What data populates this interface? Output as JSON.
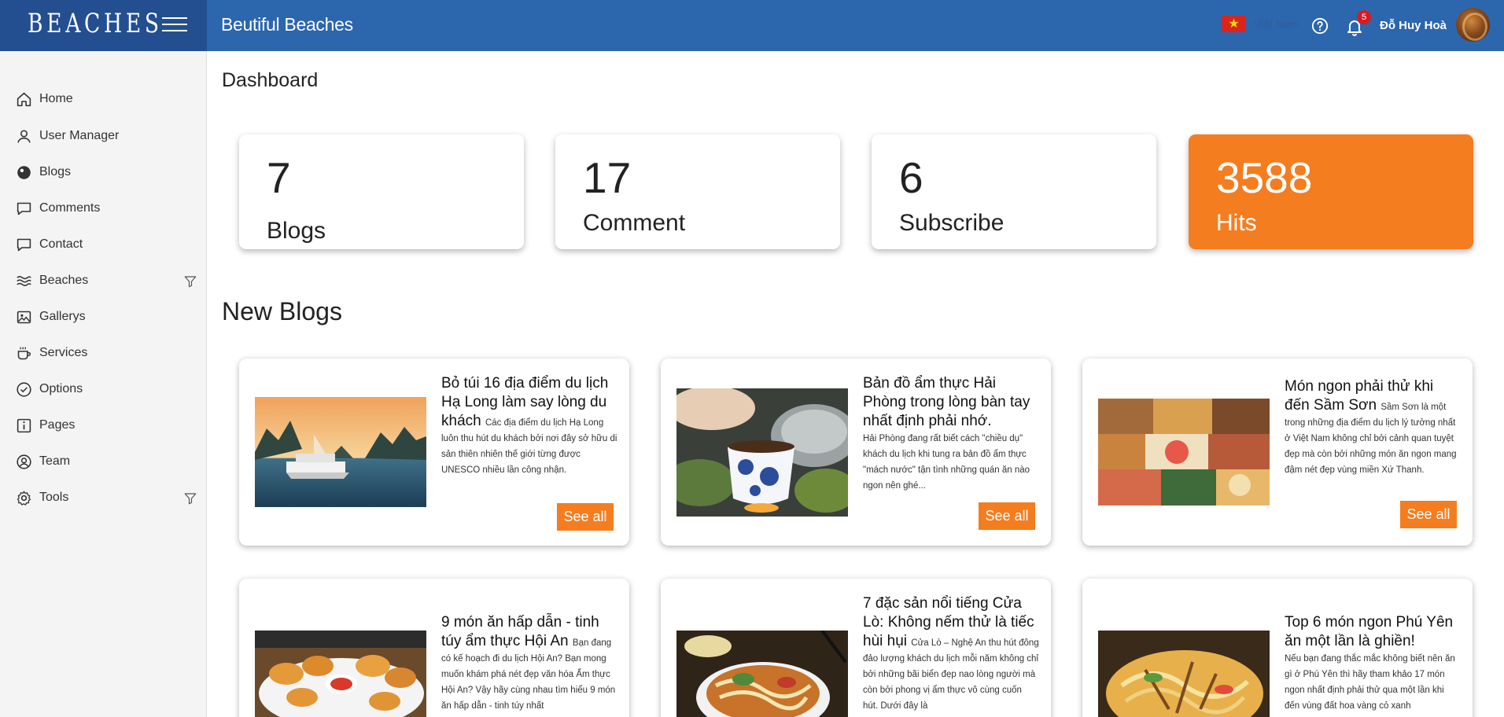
{
  "app": {
    "brand": "BEACHES",
    "site_title": "Beutiful Beaches",
    "language": "Việt Nam",
    "notifications_count": "5",
    "user_name": "Đỗ Huy Hoà"
  },
  "colors": {
    "topbar": "#2c66ad",
    "brand_bg": "#234f90",
    "accent_orange": "#f47d20",
    "sidebar_bg": "#f4f4f4"
  },
  "sidebar": {
    "items": [
      {
        "label": "Home",
        "icon": "home-icon"
      },
      {
        "label": "User Manager",
        "icon": "user-icon"
      },
      {
        "label": "Blogs",
        "icon": "blog-icon"
      },
      {
        "label": "Comments",
        "icon": "comment-icon"
      },
      {
        "label": "Contact",
        "icon": "contact-icon"
      },
      {
        "label": "Beaches",
        "icon": "waves-icon",
        "filter": true
      },
      {
        "label": "Gallerys",
        "icon": "image-icon"
      },
      {
        "label": "Services",
        "icon": "coffee-icon"
      },
      {
        "label": "Options",
        "icon": "check-circle-icon"
      },
      {
        "label": "Pages",
        "icon": "info-icon"
      },
      {
        "label": "Team",
        "icon": "team-icon"
      },
      {
        "label": "Tools",
        "icon": "gear-icon",
        "filter": true
      }
    ]
  },
  "dashboard": {
    "title": "Dashboard",
    "stats": [
      {
        "value": "7",
        "label": "Blogs"
      },
      {
        "value": "17",
        "label": "Comment"
      },
      {
        "value": "6",
        "label": "Subscribe"
      },
      {
        "value": "3588",
        "label": "Hits"
      }
    ]
  },
  "new_blogs": {
    "title": "New Blogs",
    "button_label": "See all",
    "posts": [
      {
        "title": "Bỏ túi 16 địa điểm du lịch Hạ Long làm say lòng du khách",
        "excerpt": "Các địa điểm du lịch Hạ Long luôn thu hút du khách bởi nơi đây sở hữu di sản thiên nhiên thế giới từng được UNESCO nhiều lần công nhận."
      },
      {
        "title": "Bản đồ ẩm thực Hải Phòng trong lòng bàn tay nhất định phải nhớ.",
        "excerpt": "Hải Phòng đang rất biết cách \"chiều dụ\" khách du lịch khi tung ra bản đồ ẩm thực \"mách nước\" tận tình những quán ăn nào ngon nên ghé..."
      },
      {
        "title": "Món ngon phải thử khi đến Sầm Sơn",
        "excerpt": "Sầm Sơn là một trong những địa điểm du lịch lý tưởng nhất ở Việt Nam không chỉ bởi cảnh quan tuyệt đẹp mà còn bởi những món ăn ngon mang đậm nét đẹp vùng miền Xứ Thanh."
      },
      {
        "title": "9 món ăn hấp dẫn - tinh túy ẩm thực Hội An",
        "excerpt": "Bạn đang có kế hoạch đi du lịch Hội An? Bạn mong muốn khám phá nét đẹp văn hóa Ẩm thực Hội An? Vậy hãy cùng nhau tìm hiểu 9 món ăn hấp dẫn - tinh túy nhất"
      },
      {
        "title": "7 đặc sản nổi tiếng Cửa Lò: Không nếm thử là tiếc hùi hụi",
        "excerpt": "Cửa Lò – Nghệ An thu hút đông đảo lượng khách du lịch mỗi năm không chỉ bởi những bãi biển đẹp nao lòng người mà còn bởi phong vị ẩm thực vô cùng cuốn hút. Dưới đây là"
      },
      {
        "title": "Top 6 món ngon Phú Yên ăn một lần là ghiền!",
        "excerpt": "Nếu bạn đang thắc mắc không biết nên ăn gì ở Phú Yên thì hãy tham khảo 17 món ngon nhất định phải thử qua một lần khi đến vùng đất hoa vàng cỏ xanh"
      }
    ]
  }
}
